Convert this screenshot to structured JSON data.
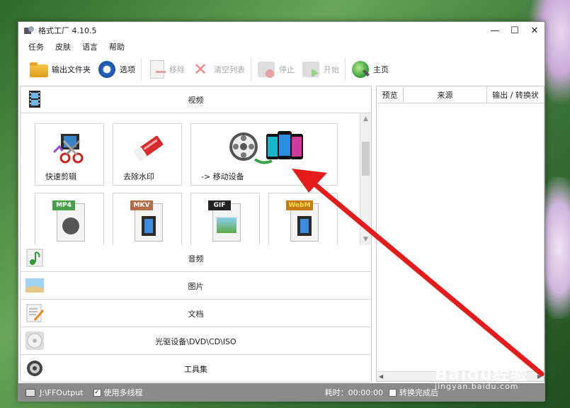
{
  "window": {
    "title": "格式工厂 4.10.5"
  },
  "controls": {
    "minimize": "—",
    "maximize": "☐",
    "close": "✕"
  },
  "menu": [
    "任务",
    "皮肤",
    "语言",
    "帮助"
  ],
  "toolbar": {
    "output_folder": "输出文件夹",
    "options": "选项",
    "remove": "移除",
    "clear_list": "清空列表",
    "stop": "停止",
    "start": "开始",
    "home": "主页"
  },
  "categories": {
    "video": "视频",
    "audio": "音频",
    "image": "图片",
    "document": "文档",
    "disc": "光驱设备\\DVD\\CD\\ISO",
    "tools": "工具集"
  },
  "video_tiles": {
    "quick_clip": "快速剪辑",
    "remove_watermark": "去除水印",
    "mobile": "-> 移动设备",
    "mp4_badge": "MP4",
    "mkv_badge": "MKV",
    "gif_badge": "GIF",
    "webm_badge": "WebM"
  },
  "task_table": {
    "columns": [
      "预览",
      "来源",
      "输出 / 转换状"
    ]
  },
  "statusbar": {
    "output_path": "J:\\FFOutput",
    "multithread": "使用多线程",
    "elapsed": "耗时：00:00:00",
    "after_convert": "转换完成后"
  },
  "watermark": {
    "logo": "Baidu经验",
    "site": "jingyan.baidu.com"
  },
  "colors": {
    "arrow": "#e31b1b",
    "statusbar": "#8a8a8a"
  }
}
